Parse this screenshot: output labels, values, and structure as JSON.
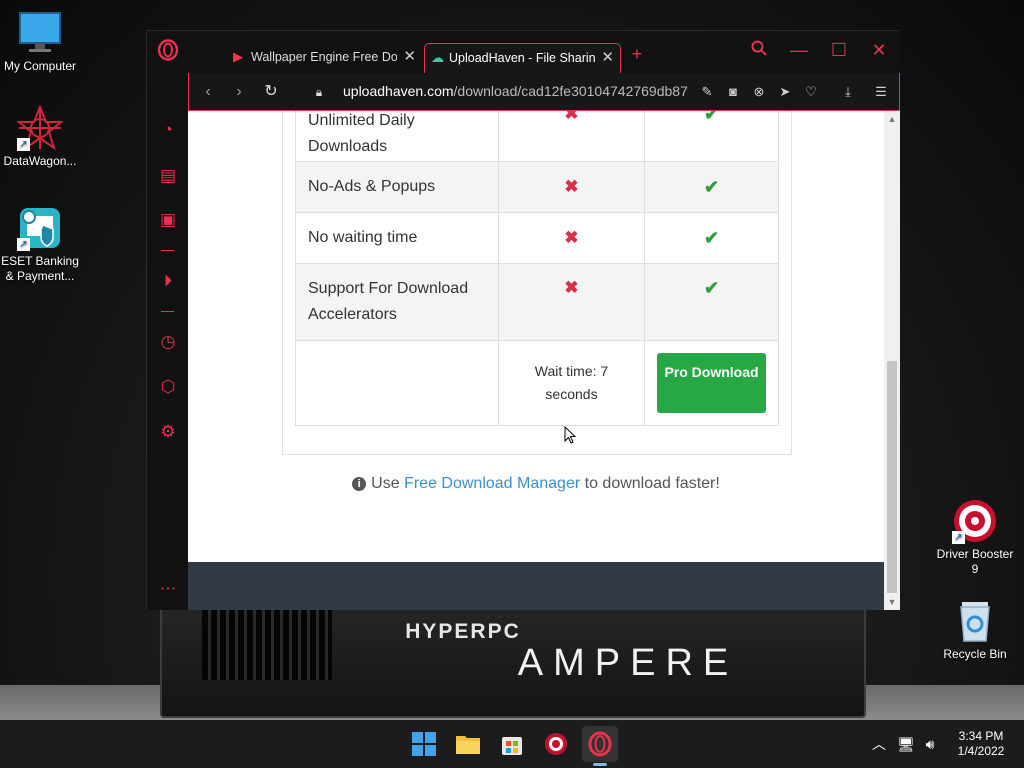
{
  "desktop": {
    "icons": [
      {
        "label": "My Computer",
        "icon": "monitor-icon"
      },
      {
        "label": "DataWagon...",
        "icon": "datawagon-icon"
      },
      {
        "label": "ESET Banking & Payment...",
        "icon": "eset-icon"
      },
      {
        "label": "Driver Booster 9",
        "icon": "driver-booster-icon"
      },
      {
        "label": "Recycle Bin",
        "icon": "recycle-bin-icon"
      }
    ],
    "wallpaper_brand": "HYPERPC",
    "wallpaper_model": "AMPERE"
  },
  "browser": {
    "tabs": [
      {
        "label": "Wallpaper Engine Free Dow",
        "icon": "youtube-icon",
        "active": false
      },
      {
        "label": "UploadHaven - File Sharing",
        "icon": "cloud-icon",
        "active": true
      }
    ],
    "address": {
      "host": "uploadhaven.com",
      "path": "/download/cad12fe30104742769db87"
    },
    "accent_color": "#e8314e"
  },
  "page": {
    "rows": [
      {
        "feature": "Unlimited Daily Downloads",
        "free": "x",
        "pro": "check"
      },
      {
        "feature": "No-Ads & Popups",
        "free": "x",
        "pro": "check"
      },
      {
        "feature": "No waiting time",
        "free": "x",
        "pro": "check"
      },
      {
        "feature": "Support For Download Accelerators",
        "free": "x",
        "pro": "check"
      }
    ],
    "wait_text": "Wait time: 7 seconds",
    "pro_button": "Pro Download",
    "note": {
      "prefix": "Use",
      "link": "Free Download Manager",
      "suffix": "to download faster!"
    }
  },
  "taskbar": {
    "clock_time": "3:34 PM",
    "clock_date": "1/4/2022"
  }
}
